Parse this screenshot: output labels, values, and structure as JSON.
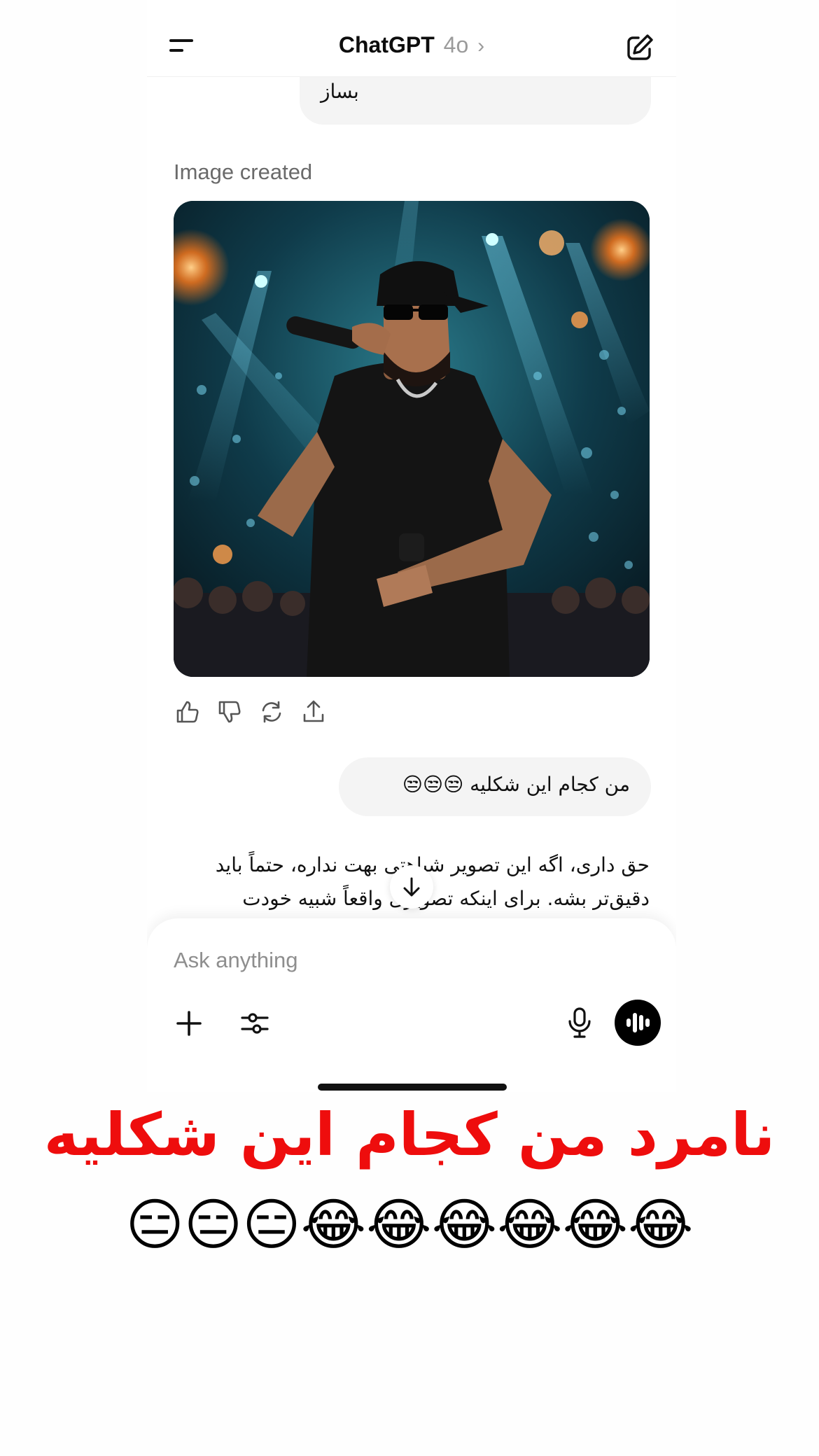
{
  "header": {
    "app_name": "ChatGPT",
    "model": "4o",
    "chevron": "›",
    "menu_icon": "menu-icon",
    "compose_icon": "new-chat-icon"
  },
  "conversation": {
    "previous_user_message_tail": "بساز",
    "image_label": "Image created",
    "image_description": "rapper-performing-concert",
    "actions": [
      "thumbs-up-icon",
      "thumbs-down-icon",
      "regenerate-icon",
      "share-icon"
    ],
    "user_message": "من کجام این شکلیه 😒😒😒",
    "assistant_reply_line1": "حق داری، اگه این تصویر شباهتی بهت نداره، حتماً باید",
    "assistant_reply_line2": "دقیق‌تر بشه. برای اینکه تصویری واقعاً شبیه خودت"
  },
  "composer": {
    "placeholder": "Ask anything",
    "plus_icon": "plus-icon",
    "tools_icon": "sliders-icon",
    "mic_icon": "mic-icon",
    "voice_icon": "voice-mode-icon"
  },
  "caption": {
    "text": "نامرد من کجام این شکلیه",
    "emojis": "😑😑😑😂😂😂😂😂😂"
  },
  "colors": {
    "accent_caption": "#ee0d0d",
    "bubble": "#f4f4f4",
    "voice_button": "#000000"
  }
}
